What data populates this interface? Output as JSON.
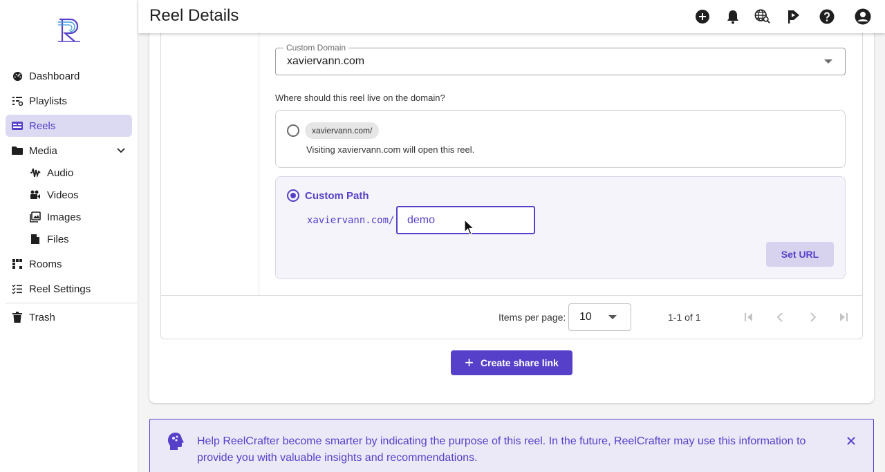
{
  "header": {
    "title": "Reel Details"
  },
  "sidebar": {
    "items": [
      {
        "label": "Dashboard",
        "icon": "dashboard-icon"
      },
      {
        "label": "Playlists",
        "icon": "playlist-icon"
      },
      {
        "label": "Reels",
        "icon": "reels-icon",
        "active": true
      },
      {
        "label": "Media",
        "icon": "folder-icon"
      },
      {
        "label": "Audio",
        "icon": "audio-icon"
      },
      {
        "label": "Videos",
        "icon": "video-icon"
      },
      {
        "label": "Images",
        "icon": "image-icon"
      },
      {
        "label": "Files",
        "icon": "file-icon"
      },
      {
        "label": "Rooms",
        "icon": "rooms-icon"
      },
      {
        "label": "Reel Settings",
        "icon": "settings-list-icon"
      },
      {
        "label": "Trash",
        "icon": "trash-icon"
      }
    ]
  },
  "form": {
    "domain_label": "Custom Domain",
    "domain_value": "xaviervann.com",
    "question": "Where should this reel live on the domain?",
    "root_option": {
      "chip": "xaviervann.com/",
      "description": "Visiting xaviervann.com will open this reel."
    },
    "custom_option": {
      "title": "Custom Path",
      "prefix": "xaviervann.com/",
      "value": "demo",
      "button": "Set URL"
    }
  },
  "pagination": {
    "items_per_page_label": "Items per page:",
    "items_per_page": "10",
    "range": "1-1 of 1"
  },
  "create_button": {
    "label": "Create share link"
  },
  "banner": {
    "text": "Help ReelCrafter become smarter by indicating the purpose of this reel. In the future, ReelCrafter may use this information to provide you with valuable insights and recommendations."
  },
  "colors": {
    "accent": "#5740c9",
    "active_nav": "#dcd9f2",
    "banner_bg": "#ebe9f8"
  }
}
